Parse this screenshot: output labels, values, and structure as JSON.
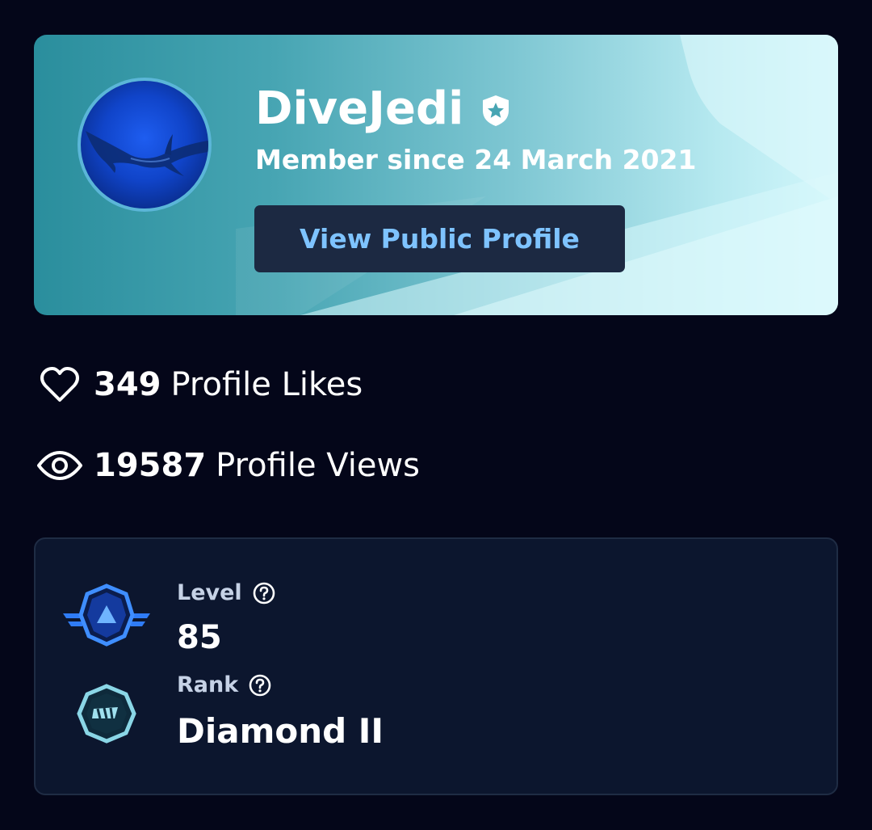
{
  "profile": {
    "username": "DiveJedi",
    "member_since": "Member since 24 March 2021",
    "view_profile_label": "View Public Profile",
    "verified_icon": "shield-star-icon",
    "avatar": "shark-avatar"
  },
  "stats": {
    "likes": {
      "icon": "heart-outline-icon",
      "count": "349",
      "label": "Profile Likes"
    },
    "views": {
      "icon": "eye-icon",
      "count": "19587",
      "label": "Profile Views"
    }
  },
  "progress": {
    "level": {
      "label": "Level",
      "value": "85",
      "icon": "level-badge-icon",
      "help_icon": "help-circle-icon"
    },
    "rank": {
      "label": "Rank",
      "value": "Diamond II",
      "icon": "diamond-rank-badge-icon",
      "help_icon": "help-circle-icon"
    }
  },
  "colors": {
    "background": "#040619",
    "card_gradient_start": "#2a8e9d",
    "card_gradient_end": "#d3f7fb",
    "button_bg": "#1c2942",
    "button_text": "#7ec3ff",
    "panel_bg": "#0c162e",
    "level_badge_blue": "#2f7cf6",
    "rank_badge_teal": "#8ad6e6"
  }
}
